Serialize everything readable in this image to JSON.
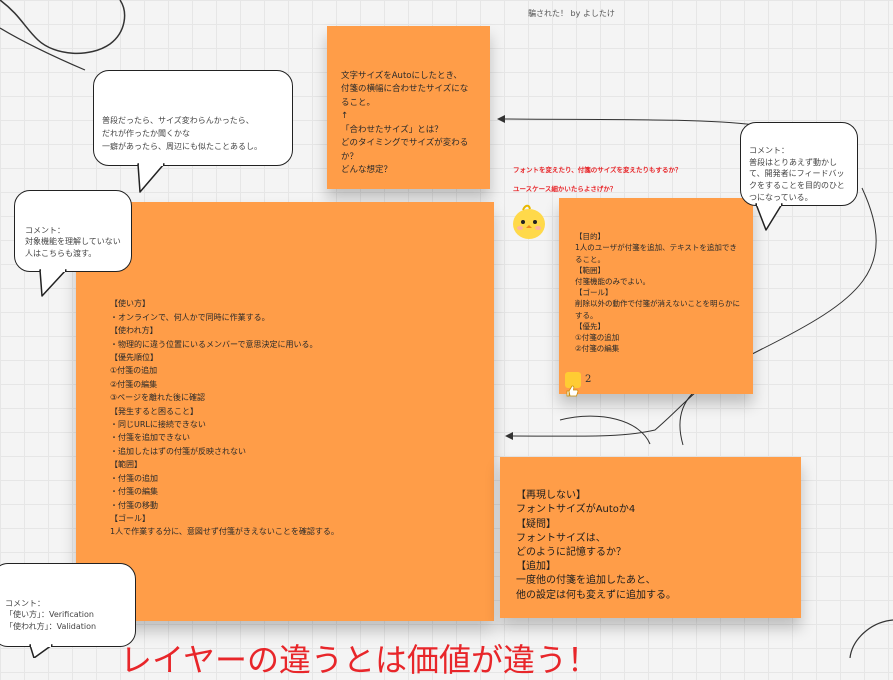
{
  "header": {
    "byline": "騙された！ by よしたけ"
  },
  "notes": {
    "auto_question": "文字サイズをAutoにしたとき、\n付箋の横幅に合わせたサイズになること。\n↑\n「合わせたサイズ」とは？\nどのタイミングでサイズが変わるか？\nどんな想定？",
    "main_test": "【使い方】\n・オンラインで、何人かで同時に作業する。\n【使われ方】\n・物理的に違う位置にいるメンバーで意思決定に用いる。\n【優先順位】\n①付箋の追加\n②付箋の編集\n③ページを離れた後に確認\n【発生すると困ること】\n・同じURLに接続できない\n・付箋を追加できない\n・追加したはずの付箋が反映されない\n【範囲】\n・付箋の追加\n・付箋の編集\n・付箋の移動\n【ゴール】\n1人で作業する分に、意図せず付箋がきえないことを確認する。",
    "purpose": "【目的】\n1人のユーザが付箋を追加、テキストを追加できること。\n【範囲】\n付箋機能のみでよい。\n【ゴール】\n削除以外の動作で付箋が消えないことを明らかにする。\n【優先】\n①付箋の追加\n②付箋の編集",
    "not_reproduced": "【再現しない】\nフォントサイズがAutoか4\n【疑問】\nフォントサイズは、\nどのように記憶するか？\n【追加】\n一度他の付箋を追加したあと、\n他の設定は何も変えずに追加する。"
  },
  "reaction": {
    "count": "2",
    "icon": "thumbs-up-icon"
  },
  "red_notes": {
    "line1": "フォントを変えたり、付箋のサイズを変えたりもするか？",
    "line2": "ユースケース細かいたらよさげか？"
  },
  "comments": {
    "top_bubble": "普段だったら、サイズ変わらんかったら、\nだれが作ったか聞くかな\n一癖があったら、周辺にも似たことあるし。",
    "left_comment": "コメント：\n対象機能を理解していない人はこちらも渡す。",
    "right_comment": "コメント：\n普段はとりあえず動かして、開発者にフィードバックをすることを目的のひとつになっている。",
    "bottom_comment": "コメント：\n「使い方」：Verification\n「使われ方」：Validation"
  },
  "bottom_heading": "レイヤーの違うとは価値が違う！",
  "colors": {
    "sticky": "#ff9d48",
    "red": "#e8262a",
    "grid": "#e6e6e6"
  }
}
